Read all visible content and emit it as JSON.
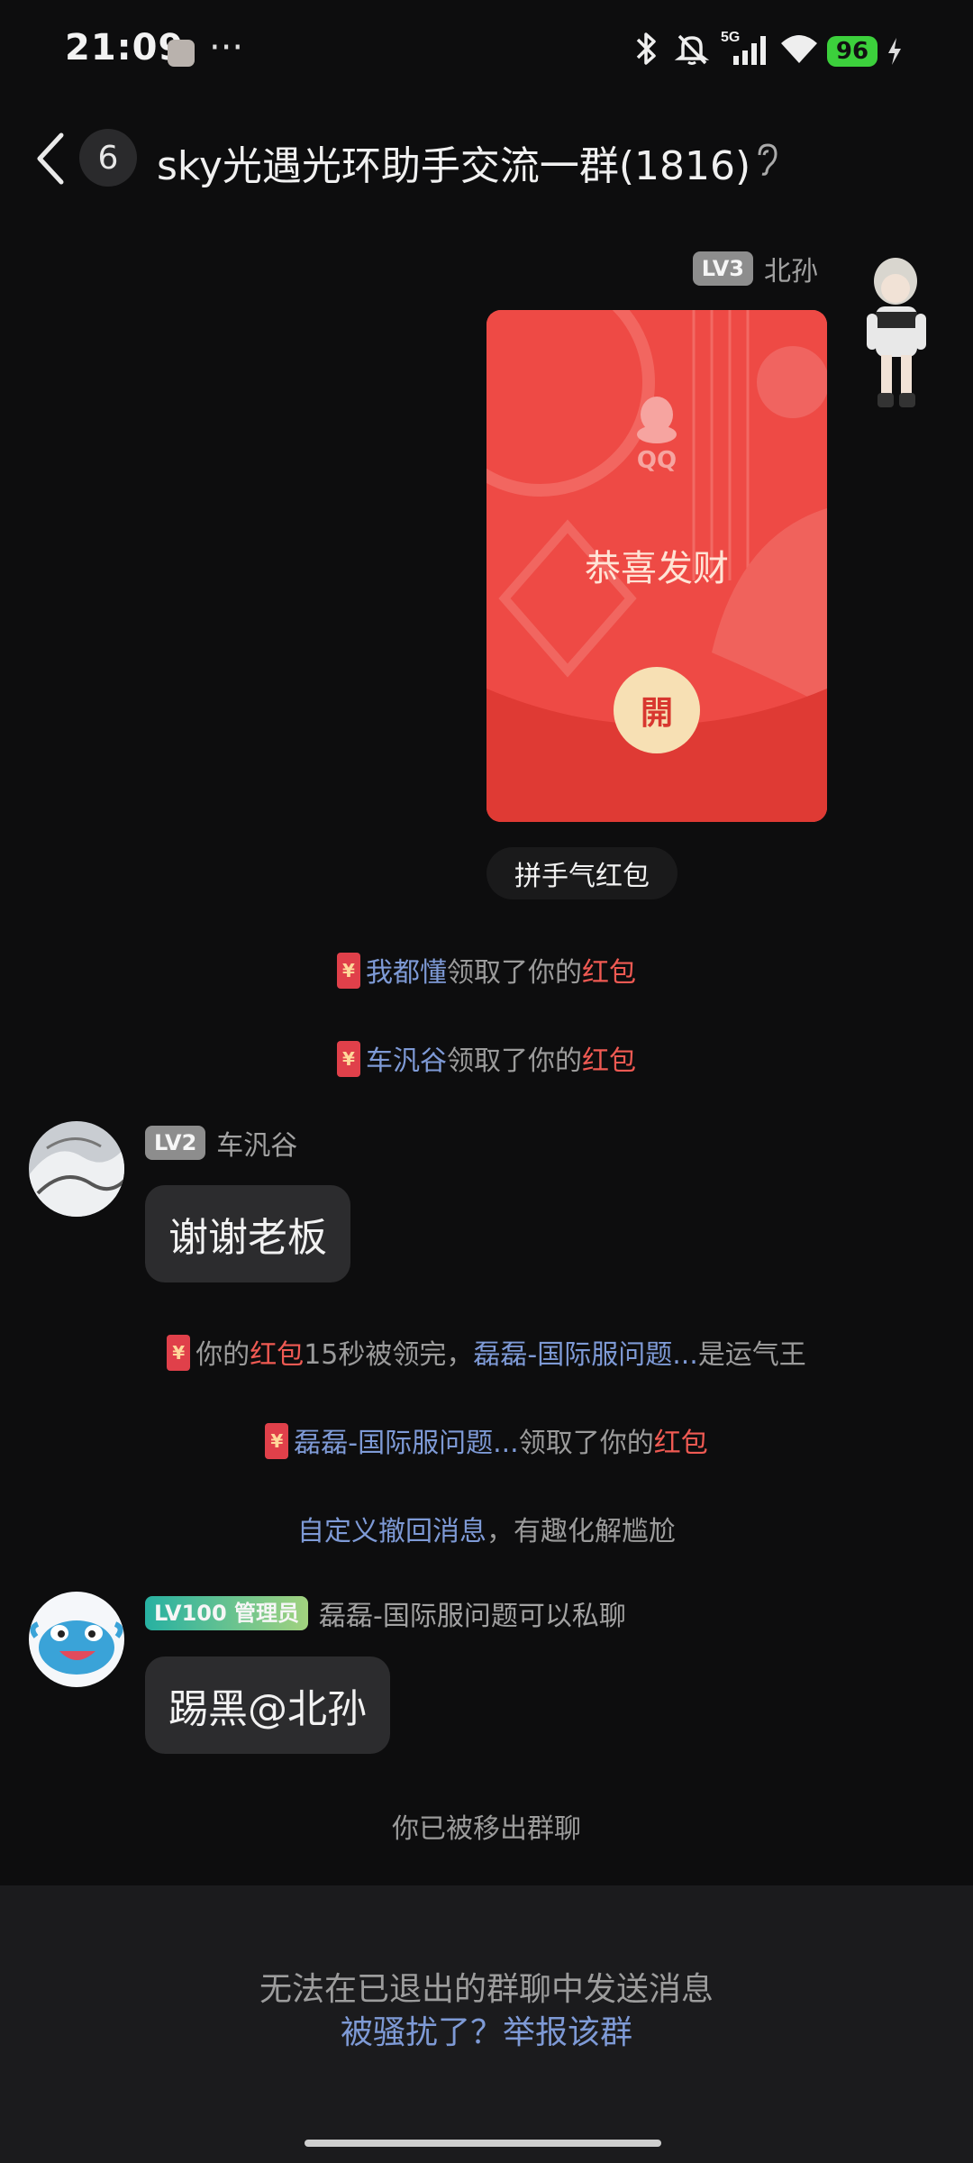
{
  "status_bar": {
    "time": "21:09",
    "dots": "···",
    "network": "5G",
    "battery": "96"
  },
  "header": {
    "unread_count": "6",
    "title": "sky光遇光环助手交流一群(1816)"
  },
  "messages": {
    "me": {
      "level": "LV3",
      "name": "北孙"
    },
    "red_packet": {
      "brand": "QQ",
      "greeting": "恭喜发财",
      "open_label": "開",
      "type_label": "拼手气红包"
    },
    "sys1": {
      "name": "我都懂",
      "text": "领取了你的",
      "link": "红包"
    },
    "sys2": {
      "name": "车汎谷",
      "text": "领取了你的",
      "link": "红包"
    },
    "msg1": {
      "level": "LV2",
      "name": "车汎谷",
      "text": "谢谢老板"
    },
    "sys3": {
      "p1": "你的",
      "link": "红包",
      "p2": "15秒被领完，",
      "name": "磊磊-国际服问题...",
      "p3": "是运气王"
    },
    "sys4": {
      "name": "磊磊-国际服问题...",
      "text": "领取了你的",
      "link": "红包"
    },
    "tip": {
      "link": "自定义撤回消息",
      "text": "，有趣化解尴尬"
    },
    "msg2": {
      "level": "LV100 管理员",
      "name": "磊磊-国际服问题可以私聊",
      "text": "踢黑@北孙"
    },
    "removed": "你已被移出群聊"
  },
  "bottom": {
    "cannot_send": "无法在已退出的群聊中发送消息",
    "report": "被骚扰了？举报该群"
  },
  "colors": {
    "background": "#0d0d0e",
    "link_blue": "#7e9ad6",
    "packet_red": "#ee4a45",
    "highlight_red": "#f05a53"
  }
}
